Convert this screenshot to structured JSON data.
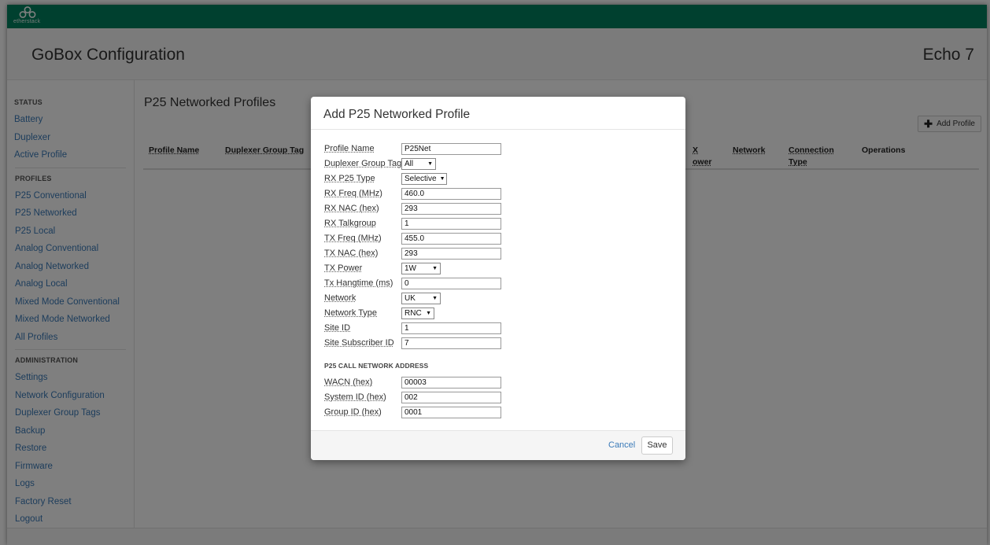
{
  "brand": {
    "logo_text": "etherstack"
  },
  "header": {
    "app_title": "GoBox Configuration",
    "device_name": "Echo 7"
  },
  "sidebar": {
    "status": {
      "heading": "STATUS",
      "items": [
        "Battery",
        "Duplexer",
        "Active Profile"
      ]
    },
    "profiles": {
      "heading": "PROFILES",
      "items": [
        "P25 Conventional",
        "P25 Networked",
        "P25 Local",
        "Analog Conventional",
        "Analog Networked",
        "Analog Local",
        "Mixed Mode Conventional",
        "Mixed Mode Networked",
        "All Profiles"
      ]
    },
    "administration": {
      "heading": "ADMINISTRATION",
      "items": [
        "Settings",
        "Network Configuration",
        "Duplexer Group Tags",
        "Backup",
        "Restore",
        "Firmware",
        "Logs",
        "Factory Reset",
        "Logout"
      ]
    }
  },
  "main": {
    "title": "P25 Networked Profiles",
    "add_button": "Add Profile",
    "columns": [
      "Profile Name",
      "Duplexer Group Tag",
      "X",
      "ower",
      "Network",
      "Connection",
      "Type",
      "Operations"
    ]
  },
  "modal": {
    "title": "Add P25 Networked Profile",
    "fields": [
      {
        "label": "Profile Name",
        "value": "P25Net"
      },
      {
        "label": "Duplexer Group Tag",
        "value": "All"
      },
      {
        "label": "RX P25 Type",
        "value": "Selective"
      },
      {
        "label": "RX Freq (MHz)",
        "value": "460.0"
      },
      {
        "label": "RX NAC (hex)",
        "value": "293"
      },
      {
        "label": "RX Talkgroup",
        "value": "1"
      },
      {
        "label": "TX Freq (MHz)",
        "value": "455.0"
      },
      {
        "label": "TX NAC (hex)",
        "value": "293"
      },
      {
        "label": "TX Power",
        "value": "1W"
      },
      {
        "label": "Tx Hangtime (ms)",
        "value": "0"
      },
      {
        "label": "Network",
        "value": "UK"
      },
      {
        "label": "Network Type",
        "value": "RNC"
      },
      {
        "label": "Site ID",
        "value": "1"
      },
      {
        "label": "Site Subscriber ID",
        "value": "7"
      }
    ],
    "address_heading": "P25 CALL NETWORK ADDRESS",
    "address_fields": [
      {
        "label": "WACN (hex)",
        "value": "00003"
      },
      {
        "label": "System ID (hex)",
        "value": "002"
      },
      {
        "label": "Group ID (hex)",
        "value": "0001"
      }
    ],
    "cancel_label": "Cancel",
    "save_label": "Save"
  }
}
